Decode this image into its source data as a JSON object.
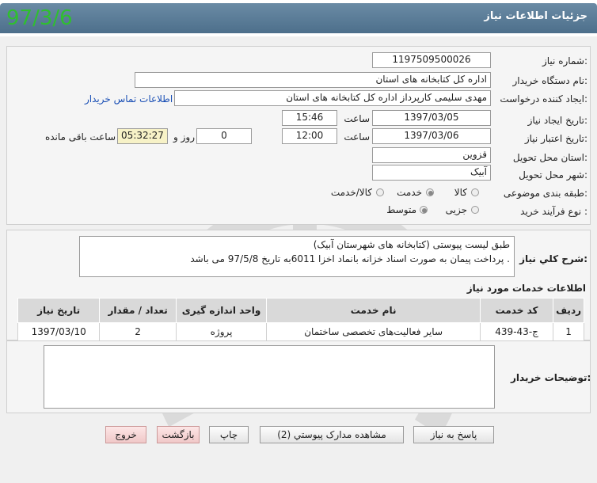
{
  "stamp": "97/3/6",
  "header": {
    "title": "جزئیات اطلاعات نیاز"
  },
  "form": {
    "need_number_label": "شماره نیاز:",
    "need_number": "1197509500026",
    "buyer_org_label": "نام دستگاه خریدار:",
    "buyer_org": "اداره کل کتابخانه های استان",
    "requester_label": "ایجاد کننده درخواست:",
    "requester": "مهدی سلیمی کارپرداز اداره کل کتابخانه های استان",
    "contact_link": "اطلاعات تماس خریدار",
    "created_date_label": "تاریخ ایجاد نیاز:",
    "created_date": "1397/03/05",
    "time_label": "ساعت",
    "created_time": "15:46",
    "valid_date_label": "تاریخ اعتبار نیاز:",
    "valid_date": "1397/03/06",
    "valid_time": "12:00",
    "days_value": "0",
    "days_label": "روز و",
    "remaining_time": "05:32:27",
    "remaining_label": "ساعت باقی مانده",
    "province_label": "استان محل تحویل:",
    "province": "قزوین",
    "city_label": "شهر محل تحویل:",
    "city": "آبیک",
    "category_label": "طبقه بندی موضوعی:",
    "category_options": [
      "کالا",
      "خدمت",
      "کالا/خدمت"
    ],
    "category_selected": "خدمت",
    "purchase_type_label": "نوع فرآیند خرید :",
    "purchase_type_options": [
      "جزیی",
      "متوسط"
    ],
    "purchase_type_selected": "متوسط"
  },
  "description": {
    "label": "شرح کلي نياز:",
    "line1": "طبق لیست پیوستی (کتابخانه های شهرستان آبیک)",
    "line2": "پرداخت پیمان به صورت اسناد خزانه بانماد اخزا 6011به تاریخ 97/5/8 می باشد ."
  },
  "services": {
    "title": "اطلاعات خدمات مورد نياز",
    "columns": [
      "رديف",
      "کد خدمت",
      "نام خدمت",
      "واحد اندازه گيری",
      "تعداد / مقدار",
      "تاريخ نياز"
    ],
    "rows": [
      [
        "1",
        "ج-43-439",
        "سایر فعالیت‌های تخصصی ساختمان",
        "پروژه",
        "2",
        "1397/03/10"
      ]
    ]
  },
  "buyer_notes": {
    "label": "توضيحات خريدار:",
    "value": ""
  },
  "buttons": {
    "reply": "پاسخ به نياز",
    "attachments": "مشاهده مدارک پيوستي (2)",
    "print": "چاپ",
    "back": "بازگشت",
    "exit": "خروج"
  }
}
